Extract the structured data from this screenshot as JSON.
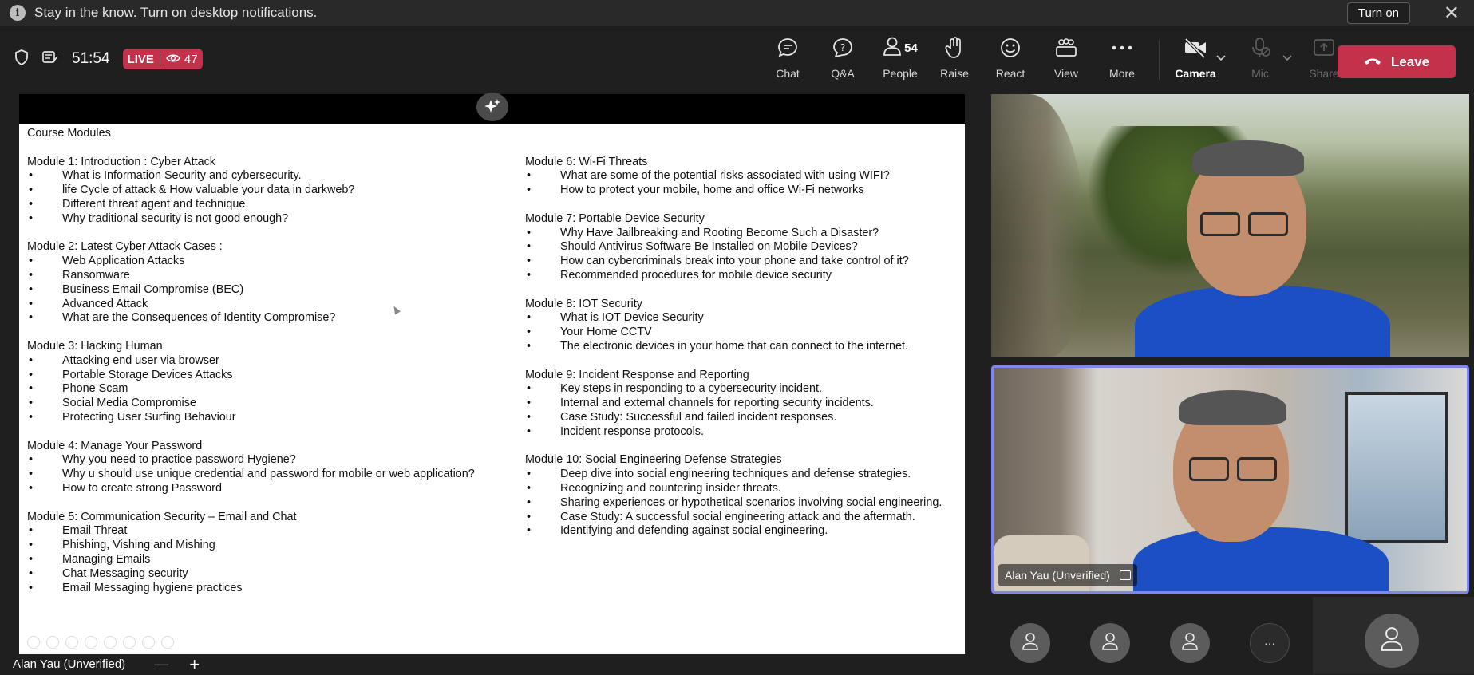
{
  "notification": {
    "message": "Stay in the know. Turn on desktop notifications.",
    "turn_on": "Turn on",
    "close": "✕"
  },
  "toolbar": {
    "timer": "51:54",
    "live_label": "LIVE",
    "viewers": "47",
    "buttons": {
      "chat": "Chat",
      "qa": "Q&A",
      "people": "People",
      "people_count": "54",
      "raise": "Raise",
      "react": "React",
      "view": "View",
      "more": "More",
      "camera": "Camera",
      "mic": "Mic",
      "share": "Share"
    },
    "leave": "Leave"
  },
  "slide": {
    "heading": "Course Modules",
    "left_modules": [
      {
        "title": "Module 1: Introduction : Cyber Attack",
        "items": [
          "What is Information Security and cybersecurity.",
          "life Cycle of attack  & How valuable your data in darkweb?",
          "Different threat agent and technique.",
          "Why traditional security is not good enough?"
        ]
      },
      {
        "title": "Module 2: Latest Cyber Attack Cases :",
        "items": [
          "Web Application Attacks",
          "Ransomware",
          "Business Email Compromise (BEC)",
          "Advanced Attack",
          "What are the Consequences of Identity Compromise?"
        ]
      },
      {
        "title": "Module 3: Hacking Human",
        "items": [
          "Attacking end user via browser",
          "Portable Storage Devices Attacks",
          "Phone Scam",
          "Social Media Compromise",
          "Protecting User Surfing Behaviour"
        ]
      },
      {
        "title": "Module 4: Manage Your Password",
        "items": [
          "Why you need to practice password Hygiene?",
          "Why u should use unique credential and password for mobile or web application?",
          "How to create strong Password"
        ]
      },
      {
        "title": "Module 5: Communication Security – Email and Chat",
        "items": [
          "Email Threat",
          "Phishing, Vishing and Mishing",
          "Managing Emails",
          "Chat Messaging  security",
          "Email Messaging hygiene practices"
        ]
      }
    ],
    "right_modules": [
      {
        "title": "Module 6: Wi-Fi Threats",
        "items": [
          "What are some of the potential risks associated with using WIFI?",
          "How to protect your mobile, home and office Wi-Fi networks"
        ]
      },
      {
        "title": "Module 7: Portable Device Security",
        "items": [
          "Why Have Jailbreaking and Rooting Become Such a Disaster?",
          "Should Antivirus Software Be Installed on Mobile Devices?",
          "How can cybercriminals break into your phone and take control of it?",
          "Recommended procedures for mobile device security"
        ]
      },
      {
        "title": "Module 8: IOT Security",
        "items": [
          "What is IOT Device Security",
          "Your Home CCTV",
          "The electronic devices in your home that can connect to the internet."
        ]
      },
      {
        "title": "Module 9: Incident Response and Reporting",
        "items": [
          "Key steps in responding to a cybersecurity incident.",
          "Internal and external channels for reporting security incidents.",
          "Case Study: Successful and failed incident responses.",
          "Incident response protocols."
        ]
      },
      {
        "title": "Module 10: Social Engineering Defense Strategies",
        "items": [
          "Deep dive into social engineering techniques and defense strategies.",
          "Recognizing and countering insider threats.",
          "Sharing experiences or hypothetical scenarios involving social engineering.",
          "Case Study: A successful social engineering attack and the aftermath.",
          "Identifying and defending against social engineering."
        ]
      }
    ],
    "bullet": "•"
  },
  "presenter_bar": {
    "name": "Alan Yau (Unverified)",
    "minimize": "—",
    "add": "+"
  },
  "video_tiles": [
    {
      "name": "Alan Yau (Unverified)"
    }
  ],
  "participants": {
    "more_label": "···"
  },
  "colors": {
    "live": "#c4314b",
    "leave": "#c4314b",
    "active_border": "#7f85f5",
    "shirt": "#1d4fc4"
  }
}
